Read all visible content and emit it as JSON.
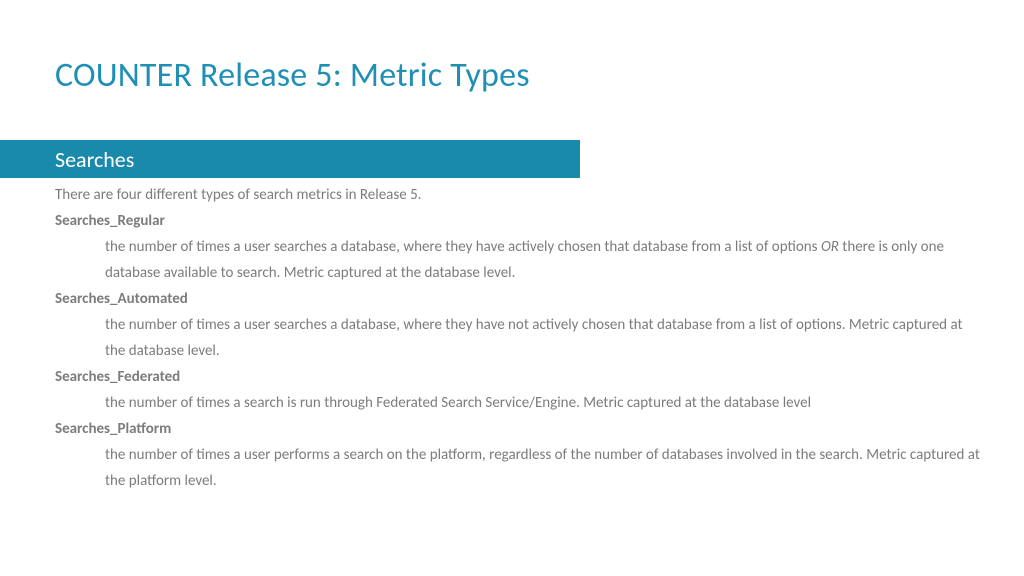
{
  "title": "COUNTER Release 5: Metric Types",
  "section": "Searches",
  "intro": "There are four different types of search metrics in Release 5.",
  "metrics": [
    {
      "name": "Searches_Regular",
      "desc_pre": "the number of times a user searches a database, where they have actively chosen that database from a list of options ",
      "desc_italic": "OR",
      "desc_post": " there is only one database available to search. Metric captured at the database level."
    },
    {
      "name": "Searches_Automated",
      "desc": "the number of times a user searches a database, where they have not actively chosen that database from a list of options. Metric captured at the database level."
    },
    {
      "name": "Searches_Federated",
      "desc": "the number of times a search is run through Federated Search Service/Engine. Metric captured at the database level"
    },
    {
      "name": "Searches_Platform",
      "desc": "the number of times a user performs a search on the platform, regardless of the number of databases involved in the search. Metric captured at the platform level."
    }
  ]
}
